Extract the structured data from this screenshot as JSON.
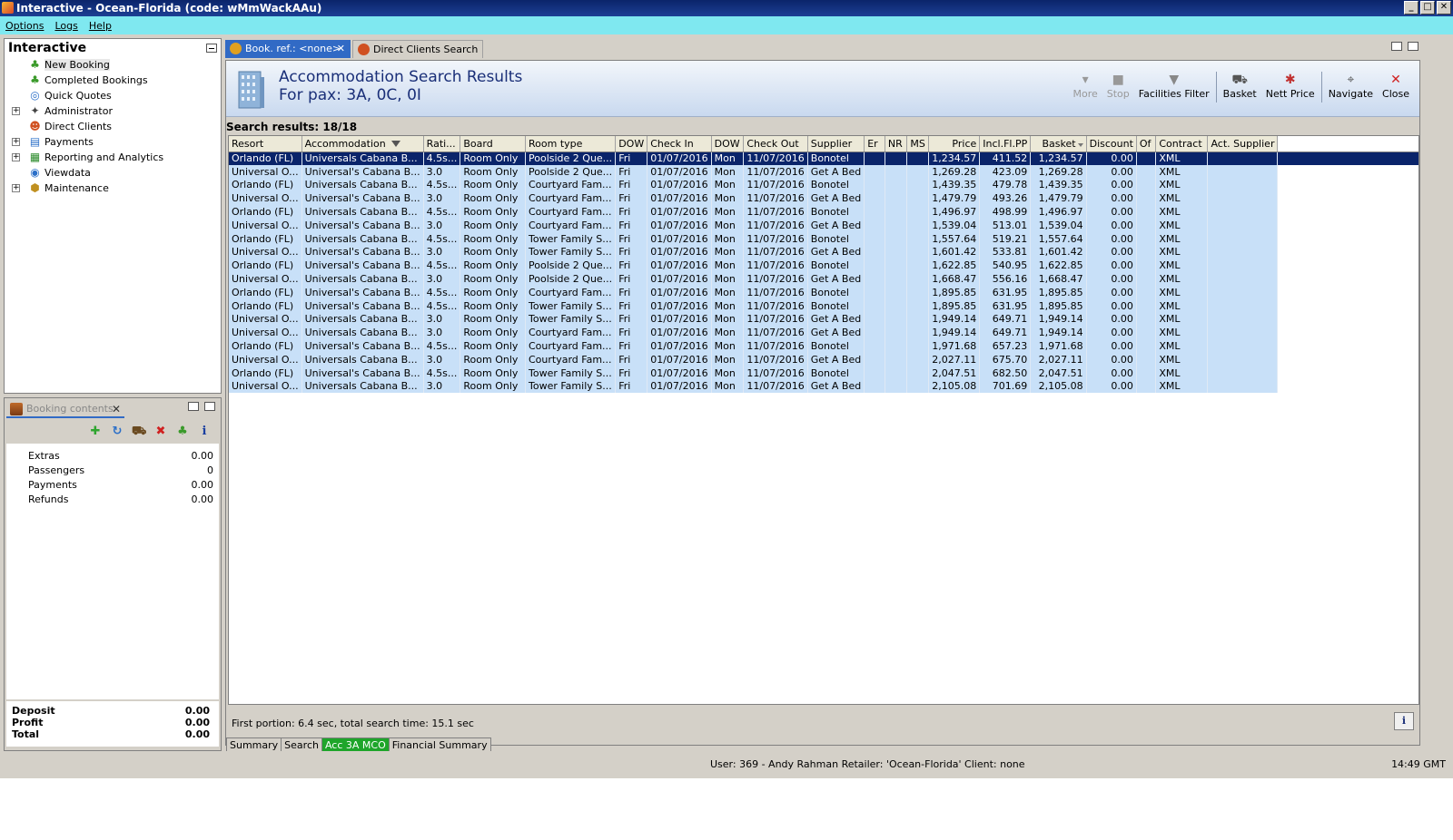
{
  "window": {
    "title": "Interactive - Ocean-Florida (code: wMmWackAAu)",
    "buttons": [
      "_",
      "□",
      "✕"
    ]
  },
  "menu": [
    "Options",
    "Logs",
    "Help"
  ],
  "nav_panel": {
    "title": "Interactive",
    "items": [
      {
        "label": "New Booking",
        "icon": "palm-tree-icon",
        "expandable": false,
        "selected": true
      },
      {
        "label": "Completed Bookings",
        "icon": "palm-tree-icon",
        "expandable": false
      },
      {
        "label": "Quick Quotes",
        "icon": "globe-icon",
        "expandable": false
      },
      {
        "label": "Administrator",
        "icon": "admin-icon",
        "expandable": true
      },
      {
        "label": "Direct Clients",
        "icon": "client-icon",
        "expandable": false
      },
      {
        "label": "Payments",
        "icon": "payments-icon",
        "expandable": true
      },
      {
        "label": "Reporting and Analytics",
        "icon": "report-icon",
        "expandable": true
      },
      {
        "label": "Viewdata",
        "icon": "viewdata-icon",
        "expandable": false
      },
      {
        "label": "Maintenance",
        "icon": "maintenance-icon",
        "expandable": true
      }
    ]
  },
  "basket_panel": {
    "tab_label": "Booking contents",
    "tools": [
      "add-icon",
      "refresh-icon",
      "basket-icon",
      "delete-icon",
      "palm-tree-icon",
      "info-icon"
    ],
    "rows": [
      {
        "label": "Extras",
        "value": "0.00"
      },
      {
        "label": "Passengers",
        "value": "0"
      },
      {
        "label": "Payments",
        "value": "0.00"
      },
      {
        "label": "Refunds",
        "value": "0.00"
      }
    ],
    "totals": [
      {
        "label": "Deposit",
        "value": "0.00"
      },
      {
        "label": "Profit",
        "value": "0.00"
      },
      {
        "label": "Total",
        "value": "0.00"
      }
    ]
  },
  "tabs": [
    {
      "label": "Book. ref.: <none>",
      "active": true
    },
    {
      "label": "Direct Clients Search",
      "active": false
    }
  ],
  "header": {
    "title": "Accommodation Search Results",
    "subtitle": "For pax: 3A, 0C, 0I"
  },
  "toolbar": [
    {
      "label": "More",
      "icon": "more-icon",
      "disabled": true
    },
    {
      "label": "Stop",
      "icon": "stop-icon",
      "disabled": true
    },
    {
      "label": "Facilities Filter",
      "icon": "filter-icon",
      "disabled": false
    },
    {
      "label": "Basket",
      "icon": "basket-icon",
      "disabled": false
    },
    {
      "label": "Nett Price",
      "icon": "nett-price-icon",
      "disabled": false
    },
    {
      "label": "Navigate",
      "icon": "navigate-icon",
      "disabled": false
    },
    {
      "label": "Close",
      "icon": "close-icon",
      "disabled": false
    }
  ],
  "results_count": "Search results: 18/18",
  "columns": [
    "Resort",
    "Accommodation",
    "Rati...",
    "Board",
    "Room type",
    "DOW",
    "Check In",
    "DOW",
    "Check Out",
    "Supplier",
    "Er",
    "NR",
    "MS",
    "Price",
    "Incl.Fl.PP",
    "Basket",
    "Discount",
    "Of",
    "Contract",
    "Act. Supplier"
  ],
  "rows": [
    [
      "Orlando (FL)",
      "Universals Cabana B...",
      "4.5s...",
      "Room Only",
      "Poolside 2 Que...",
      "Fri",
      "01/07/2016",
      "Mon",
      "11/07/2016",
      "Bonotel",
      "",
      "",
      "",
      "1,234.57",
      "411.52",
      "1,234.57",
      "0.00",
      "",
      "XML",
      ""
    ],
    [
      "Universal O...",
      "Universal's Cabana B...",
      "3.0",
      "Room Only",
      "Poolside 2 Que...",
      "Fri",
      "01/07/2016",
      "Mon",
      "11/07/2016",
      "Get A Bed",
      "",
      "",
      "",
      "1,269.28",
      "423.09",
      "1,269.28",
      "0.00",
      "",
      "XML",
      ""
    ],
    [
      "Orlando (FL)",
      "Universals Cabana B...",
      "4.5s...",
      "Room Only",
      "Courtyard Fam...",
      "Fri",
      "01/07/2016",
      "Mon",
      "11/07/2016",
      "Bonotel",
      "",
      "",
      "",
      "1,439.35",
      "479.78",
      "1,439.35",
      "0.00",
      "",
      "XML",
      ""
    ],
    [
      "Universal O...",
      "Universal's Cabana B...",
      "3.0",
      "Room Only",
      "Courtyard Fam...",
      "Fri",
      "01/07/2016",
      "Mon",
      "11/07/2016",
      "Get A Bed",
      "",
      "",
      "",
      "1,479.79",
      "493.26",
      "1,479.79",
      "0.00",
      "",
      "XML",
      ""
    ],
    [
      "Orlando (FL)",
      "Universals Cabana B...",
      "4.5s...",
      "Room Only",
      "Courtyard Fam...",
      "Fri",
      "01/07/2016",
      "Mon",
      "11/07/2016",
      "Bonotel",
      "",
      "",
      "",
      "1,496.97",
      "498.99",
      "1,496.97",
      "0.00",
      "",
      "XML",
      ""
    ],
    [
      "Universal O...",
      "Universal's Cabana B...",
      "3.0",
      "Room Only",
      "Courtyard Fam...",
      "Fri",
      "01/07/2016",
      "Mon",
      "11/07/2016",
      "Get A Bed",
      "",
      "",
      "",
      "1,539.04",
      "513.01",
      "1,539.04",
      "0.00",
      "",
      "XML",
      ""
    ],
    [
      "Orlando (FL)",
      "Universals Cabana B...",
      "4.5s...",
      "Room Only",
      "Tower Family S...",
      "Fri",
      "01/07/2016",
      "Mon",
      "11/07/2016",
      "Bonotel",
      "",
      "",
      "",
      "1,557.64",
      "519.21",
      "1,557.64",
      "0.00",
      "",
      "XML",
      ""
    ],
    [
      "Universal O...",
      "Universal's Cabana B...",
      "3.0",
      "Room Only",
      "Tower Family S...",
      "Fri",
      "01/07/2016",
      "Mon",
      "11/07/2016",
      "Get A Bed",
      "",
      "",
      "",
      "1,601.42",
      "533.81",
      "1,601.42",
      "0.00",
      "",
      "XML",
      ""
    ],
    [
      "Orlando (FL)",
      "Universal's Cabana B...",
      "4.5s...",
      "Room Only",
      "Poolside 2 Que...",
      "Fri",
      "01/07/2016",
      "Mon",
      "11/07/2016",
      "Bonotel",
      "",
      "",
      "",
      "1,622.85",
      "540.95",
      "1,622.85",
      "0.00",
      "",
      "XML",
      ""
    ],
    [
      "Universal O...",
      "Universals Cabana B...",
      "3.0",
      "Room Only",
      "Poolside 2 Que...",
      "Fri",
      "01/07/2016",
      "Mon",
      "11/07/2016",
      "Get A Bed",
      "",
      "",
      "",
      "1,668.47",
      "556.16",
      "1,668.47",
      "0.00",
      "",
      "XML",
      ""
    ],
    [
      "Orlando (FL)",
      "Universal's Cabana B...",
      "4.5s...",
      "Room Only",
      "Courtyard Fam...",
      "Fri",
      "01/07/2016",
      "Mon",
      "11/07/2016",
      "Bonotel",
      "",
      "",
      "",
      "1,895.85",
      "631.95",
      "1,895.85",
      "0.00",
      "",
      "XML",
      ""
    ],
    [
      "Orlando (FL)",
      "Universal's Cabana B...",
      "4.5s...",
      "Room Only",
      "Tower Family S...",
      "Fri",
      "01/07/2016",
      "Mon",
      "11/07/2016",
      "Bonotel",
      "",
      "",
      "",
      "1,895.85",
      "631.95",
      "1,895.85",
      "0.00",
      "",
      "XML",
      ""
    ],
    [
      "Universal O...",
      "Universals Cabana B...",
      "3.0",
      "Room Only",
      "Tower Family S...",
      "Fri",
      "01/07/2016",
      "Mon",
      "11/07/2016",
      "Get A Bed",
      "",
      "",
      "",
      "1,949.14",
      "649.71",
      "1,949.14",
      "0.00",
      "",
      "XML",
      ""
    ],
    [
      "Universal O...",
      "Universals Cabana B...",
      "3.0",
      "Room Only",
      "Courtyard Fam...",
      "Fri",
      "01/07/2016",
      "Mon",
      "11/07/2016",
      "Get A Bed",
      "",
      "",
      "",
      "1,949.14",
      "649.71",
      "1,949.14",
      "0.00",
      "",
      "XML",
      ""
    ],
    [
      "Orlando (FL)",
      "Universal's Cabana B...",
      "4.5s...",
      "Room Only",
      "Courtyard Fam...",
      "Fri",
      "01/07/2016",
      "Mon",
      "11/07/2016",
      "Bonotel",
      "",
      "",
      "",
      "1,971.68",
      "657.23",
      "1,971.68",
      "0.00",
      "",
      "XML",
      ""
    ],
    [
      "Universal O...",
      "Universals Cabana B...",
      "3.0",
      "Room Only",
      "Courtyard Fam...",
      "Fri",
      "01/07/2016",
      "Mon",
      "11/07/2016",
      "Get A Bed",
      "",
      "",
      "",
      "2,027.11",
      "675.70",
      "2,027.11",
      "0.00",
      "",
      "XML",
      ""
    ],
    [
      "Orlando (FL)",
      "Universal's Cabana B...",
      "4.5s...",
      "Room Only",
      "Tower Family S...",
      "Fri",
      "01/07/2016",
      "Mon",
      "11/07/2016",
      "Bonotel",
      "",
      "",
      "",
      "2,047.51",
      "682.50",
      "2,047.51",
      "0.00",
      "",
      "XML",
      ""
    ],
    [
      "Universal O...",
      "Universals Cabana B...",
      "3.0",
      "Room Only",
      "Tower Family S...",
      "Fri",
      "01/07/2016",
      "Mon",
      "11/07/2016",
      "Get A Bed",
      "",
      "",
      "",
      "2,105.08",
      "701.69",
      "2,105.08",
      "0.00",
      "",
      "XML",
      ""
    ]
  ],
  "selected_row": 0,
  "status_line": "First portion: 6.4 sec, total search time: 15.1 sec",
  "bottom_tabs": [
    {
      "label": "Summary",
      "active": false
    },
    {
      "label": "Search",
      "active": false
    },
    {
      "label": "Acc 3A MCO",
      "active": true
    },
    {
      "label": "Financial Summary",
      "active": false
    }
  ],
  "statusbar": {
    "user": "User: 369 - Andy Rahman   Retailer: 'Ocean-Florida'   Client: none",
    "time": "14:49 GMT"
  },
  "colors": {
    "title_bar": "#0a246a",
    "menu_bar": "#7fe8f0",
    "row_bg": "#c8e0f8",
    "selected_row": "#0a246a",
    "active_bottom_tab": "#1ea52a"
  }
}
